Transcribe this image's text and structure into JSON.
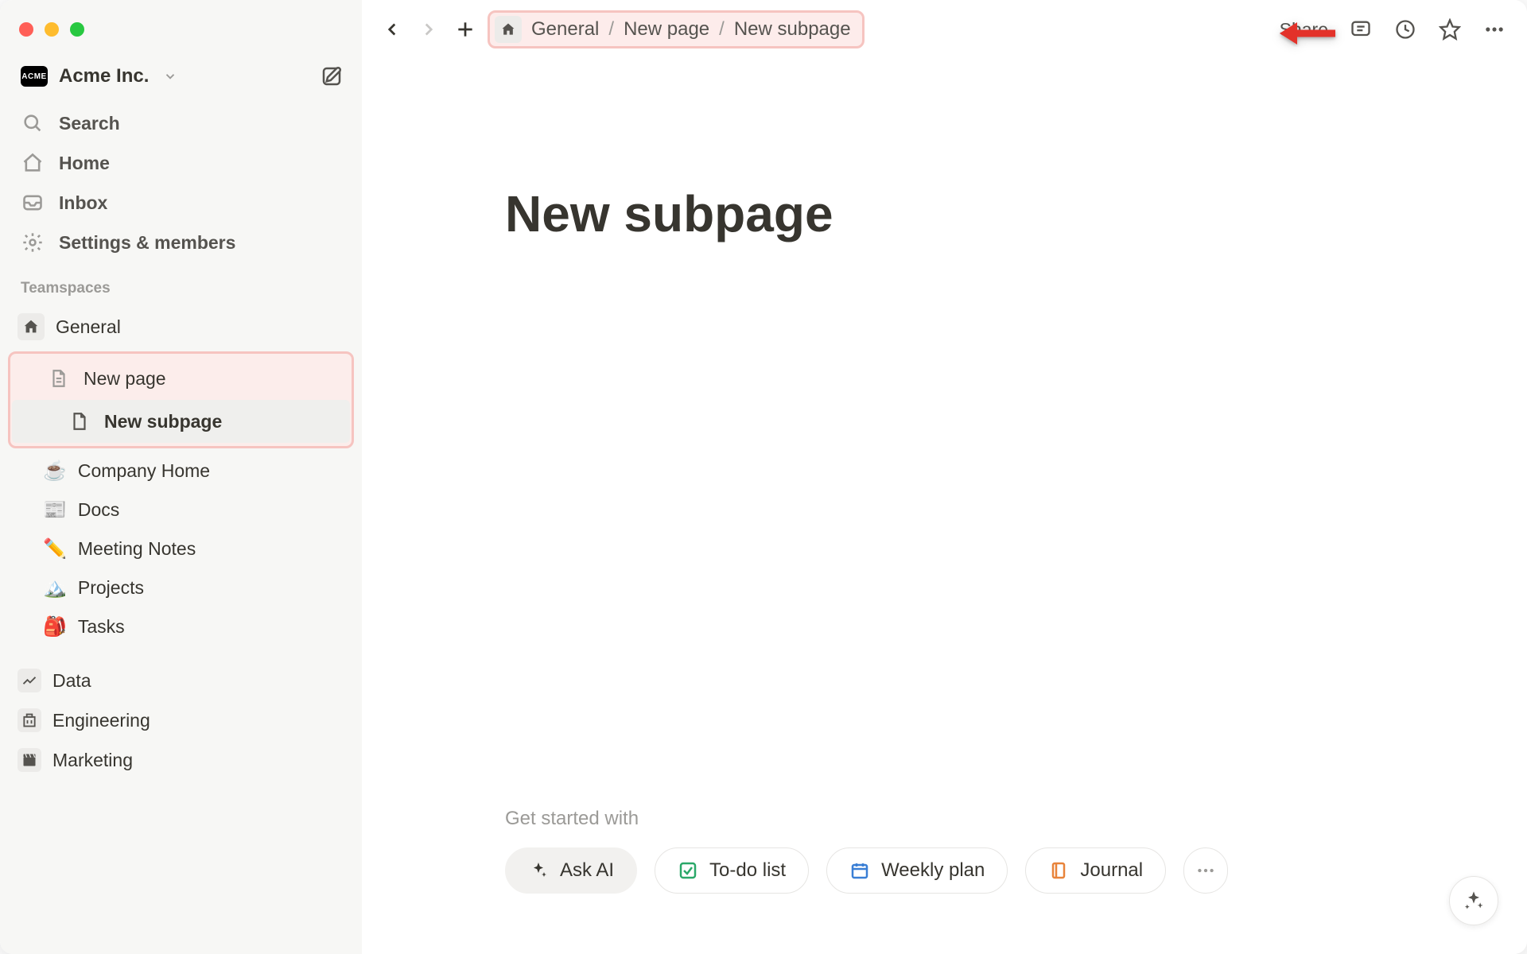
{
  "workspace": {
    "badge_text": "ACME",
    "name": "Acme Inc."
  },
  "sidebar": {
    "nav": {
      "search": "Search",
      "home": "Home",
      "inbox": "Inbox",
      "settings": "Settings & members"
    },
    "section_label": "Teamspaces",
    "teamspaces": {
      "general": "General",
      "new_page": "New page",
      "new_subpage": "New subpage",
      "company_home": "Company Home",
      "docs": "Docs",
      "meeting_notes": "Meeting Notes",
      "projects": "Projects",
      "tasks": "Tasks"
    },
    "bottom": {
      "data": "Data",
      "engineering": "Engineering",
      "marketing": "Marketing"
    }
  },
  "topbar": {
    "breadcrumb": {
      "root": "General",
      "parent": "New page",
      "current": "New subpage"
    },
    "share": "Share"
  },
  "page": {
    "title": "New subpage"
  },
  "get_started": {
    "label": "Get started with",
    "ask_ai": "Ask AI",
    "todo": "To-do list",
    "weekly": "Weekly plan",
    "journal": "Journal"
  }
}
